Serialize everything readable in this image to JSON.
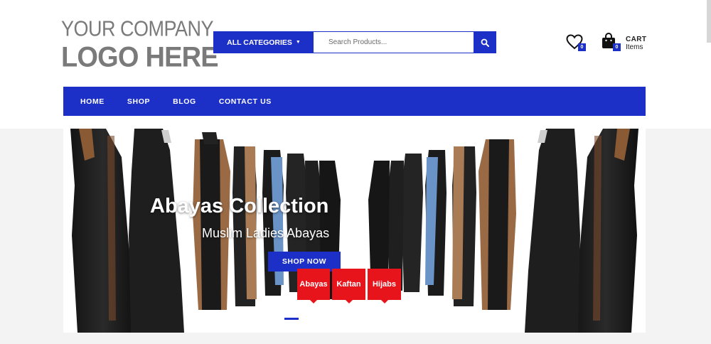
{
  "logo": {
    "line1": "YOUR COMPANY",
    "line2": "LOGO HERE"
  },
  "search": {
    "category_label": "ALL CATEGORIES",
    "placeholder": "Search Products..."
  },
  "header": {
    "wishlist_count": "0",
    "cart_count": "0",
    "cart_label": "CART",
    "cart_items_label": "Items"
  },
  "nav": {
    "items": [
      "HOME",
      "SHOP",
      "BLOG",
      "CONTACT US"
    ]
  },
  "hero": {
    "title": "Abayas Collection",
    "subtitle": "Muslim Ladies Abayas",
    "button": "SHOP NOW",
    "tags": [
      "Abayas",
      "Kaftan",
      "Hijabs"
    ]
  },
  "colors": {
    "accent": "#1c2fc7",
    "tag_red": "#e8141c",
    "logo_gray": "#7a7a7a"
  },
  "icons": [
    "caret-down-icon",
    "search-icon",
    "heart-icon",
    "shopping-bag-icon"
  ]
}
